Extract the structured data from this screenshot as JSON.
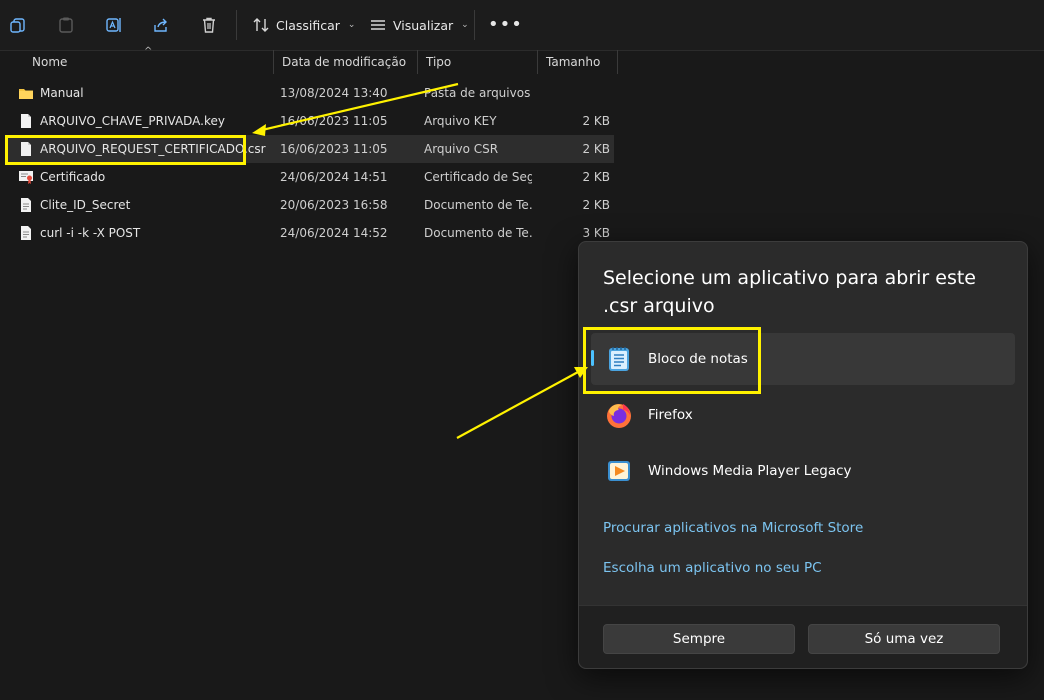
{
  "toolbar": {
    "icons": [
      "copy-icon",
      "paste-icon",
      "rename-icon",
      "share-icon",
      "delete-icon"
    ],
    "sort_label": "Classificar",
    "view_label": "Visualizar",
    "more_label": "•••"
  },
  "columns": {
    "name": "Nome",
    "date": "Data de modificação",
    "type": "Tipo",
    "size": "Tamanho"
  },
  "files": [
    {
      "name": "Manual",
      "date": "13/08/2024 13:40",
      "type": "Pasta de arquivos",
      "size": "",
      "icon": "folder-icon"
    },
    {
      "name": "ARQUIVO_CHAVE_PRIVADA.key",
      "date": "16/06/2023 11:05",
      "type": "Arquivo KEY",
      "size": "2 KB",
      "icon": "file-icon"
    },
    {
      "name": "ARQUIVO_REQUEST_CERTIFICADO.csr",
      "date": "16/06/2023 11:05",
      "type": "Arquivo CSR",
      "size": "2 KB",
      "icon": "file-icon",
      "selected": true
    },
    {
      "name": "Certificado",
      "date": "24/06/2024 14:51",
      "type": "Certificado de Seg...",
      "size": "2 KB",
      "icon": "certificate-icon"
    },
    {
      "name": "Clite_ID_Secret",
      "date": "20/06/2023 16:58",
      "type": "Documento de Te...",
      "size": "2 KB",
      "icon": "text-file-icon"
    },
    {
      "name": "curl -i -k -X POST",
      "date": "24/06/2024 14:52",
      "type": "Documento de Te...",
      "size": "3 KB",
      "icon": "text-file-icon"
    }
  ],
  "dialog": {
    "title": "Selecione um aplicativo para abrir este .csr arquivo",
    "apps": [
      {
        "label": "Bloco de notas",
        "icon": "notepad-icon",
        "active": true
      },
      {
        "label": "Firefox",
        "icon": "firefox-icon"
      },
      {
        "label": "Windows Media Player Legacy",
        "icon": "media-player-icon"
      }
    ],
    "links": [
      "Procurar aplicativos na Microsoft Store",
      "Escolha um aplicativo no seu PC"
    ],
    "always_label": "Sempre",
    "once_label": "Só uma vez"
  },
  "colors": {
    "accent": "#4cc2ff",
    "highlight": "#fff200",
    "link": "#7cc4f0",
    "folder": "#f4c542"
  }
}
